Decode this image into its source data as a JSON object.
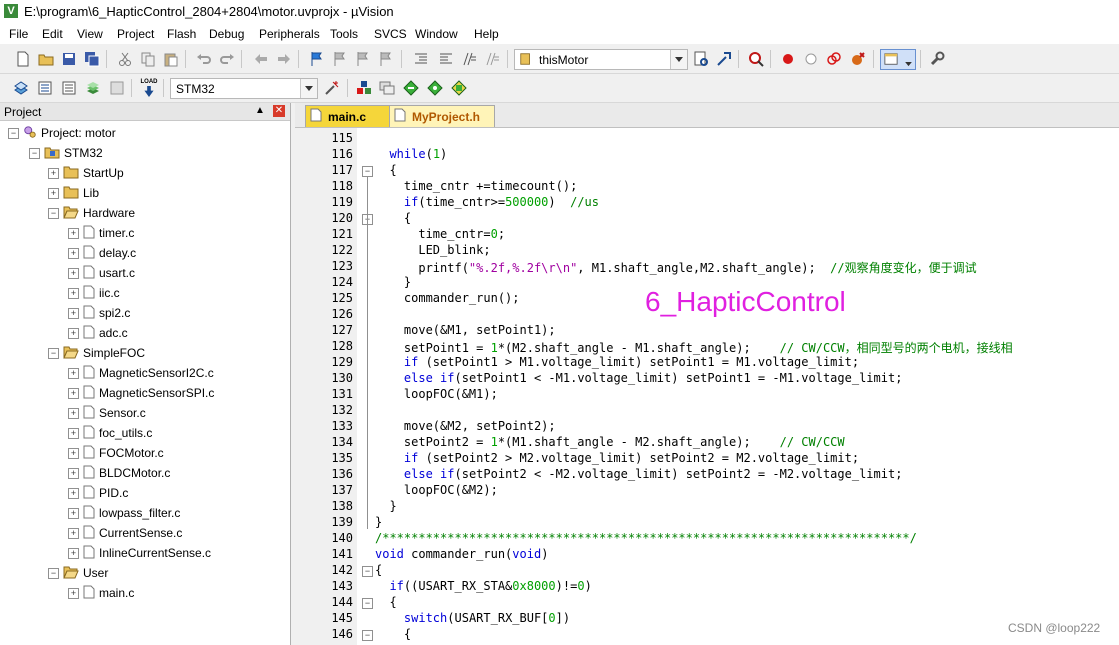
{
  "window": {
    "title": "E:\\program\\6_HapticControl_2804+2804\\motor.uvprojx - µVision",
    "app_icon": "V"
  },
  "menu": [
    "File",
    "Edit",
    "View",
    "Project",
    "Flash",
    "Debug",
    "Peripherals",
    "Tools",
    "SVCS",
    "Window",
    "Help"
  ],
  "toolbar": {
    "target_combo": "thisMotor",
    "build_target_combo": "STM32",
    "load_label": "LOAD"
  },
  "project": {
    "panel_title": "Project",
    "root": "Project: motor",
    "target": "STM32",
    "groups": [
      {
        "name": "StartUp",
        "files": []
      },
      {
        "name": "Lib",
        "files": []
      },
      {
        "name": "Hardware",
        "files": [
          "timer.c",
          "delay.c",
          "usart.c",
          "iic.c",
          "spi2.c",
          "adc.c"
        ]
      },
      {
        "name": "SimpleFOC",
        "files": [
          "MagneticSensorI2C.c",
          "MagneticSensorSPI.c",
          "Sensor.c",
          "foc_utils.c",
          "FOCMotor.c",
          "BLDCMotor.c",
          "PID.c",
          "lowpass_filter.c",
          "CurrentSense.c",
          "InlineCurrentSense.c"
        ]
      },
      {
        "name": "User",
        "files": [
          "main.c"
        ]
      }
    ]
  },
  "tabs": [
    "main.c",
    "MyProject.h"
  ],
  "code_lines": [
    {
      "n": "115",
      "t": ""
    },
    {
      "n": "116",
      "t": "  while(1)"
    },
    {
      "n": "117",
      "t": "  {"
    },
    {
      "n": "118",
      "t": "    time_cntr +=timecount();"
    },
    {
      "n": "119",
      "t": "    if(time_cntr>=500000)  //us"
    },
    {
      "n": "120",
      "t": "    {"
    },
    {
      "n": "121",
      "t": "      time_cntr=0;"
    },
    {
      "n": "122",
      "t": "      LED_blink;"
    },
    {
      "n": "123",
      "t": "      printf(\"%.2f,%.2f\\r\\n\", M1.shaft_angle,M2.shaft_angle);  //观察角度变化，便于调试"
    },
    {
      "n": "124",
      "t": "    }"
    },
    {
      "n": "125",
      "t": "    commander_run();"
    },
    {
      "n": "126",
      "t": ""
    },
    {
      "n": "127",
      "t": "    move(&M1, setPoint1);"
    },
    {
      "n": "128",
      "t": "    setPoint1 = 1*(M2.shaft_angle - M1.shaft_angle);    // CW/CCW，相同型号的两个电机，接线相"
    },
    {
      "n": "129",
      "t": "    if (setPoint1 > M1.voltage_limit) setPoint1 = M1.voltage_limit;"
    },
    {
      "n": "130",
      "t": "    else if(setPoint1 < -M1.voltage_limit) setPoint1 = -M1.voltage_limit;"
    },
    {
      "n": "131",
      "t": "    loopFOC(&M1);"
    },
    {
      "n": "132",
      "t": ""
    },
    {
      "n": "133",
      "t": "    move(&M2, setPoint2);"
    },
    {
      "n": "134",
      "t": "    setPoint2 = 1*(M1.shaft_angle - M2.shaft_angle);    // CW/CCW"
    },
    {
      "n": "135",
      "t": "    if (setPoint2 > M2.voltage_limit) setPoint2 = M2.voltage_limit;"
    },
    {
      "n": "136",
      "t": "    else if(setPoint2 < -M2.voltage_limit) setPoint2 = -M2.voltage_limit;"
    },
    {
      "n": "137",
      "t": "    loopFOC(&M2);"
    },
    {
      "n": "138",
      "t": "  }"
    },
    {
      "n": "139",
      "t": "}"
    },
    {
      "n": "140",
      "t": "/*************************************************************************/"
    },
    {
      "n": "141",
      "t": "void commander_run(void)"
    },
    {
      "n": "142",
      "t": "{"
    },
    {
      "n": "143",
      "t": "  if((USART_RX_STA&0x8000)!=0)"
    },
    {
      "n": "144",
      "t": "  {"
    },
    {
      "n": "145",
      "t": "    switch(USART_RX_BUF[0])"
    },
    {
      "n": "146",
      "t": "    {"
    }
  ],
  "overlay_title": "6_HapticControl",
  "watermark": "CSDN @loop222",
  "colors": {
    "keyword": "#0000d8",
    "number": "#00a000",
    "comment": "#008000",
    "string": "#a000a0",
    "overlay": "#e020e0",
    "active_tab": "#f5d63a",
    "inactive_tab": "#fff4b8"
  }
}
